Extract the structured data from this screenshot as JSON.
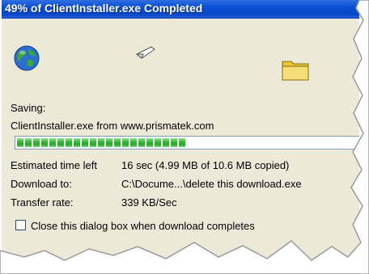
{
  "window": {
    "title": "49% of ClientInstaller.exe Completed"
  },
  "status": {
    "saving_label": "Saving:",
    "file_source": "ClientInstaller.exe from www.prismatek.com",
    "progress_percent": 49
  },
  "details": {
    "estimated_label": "Estimated time left",
    "estimated_value": "16 sec (4.99 MB of 10.6 MB copied)",
    "download_to_label": "Download to:",
    "download_to_value": "C:\\Docume...\\delete this download.exe",
    "transfer_rate_label": "Transfer rate:",
    "transfer_rate_value": "339 KB/Sec"
  },
  "options": {
    "close_on_complete_label": "Close this dialog box when download completes",
    "close_on_complete_checked": false
  },
  "icons": {
    "globe": "globe-icon",
    "paper": "flying-paper-icon",
    "folder": "folder-icon"
  },
  "colors": {
    "titlebar": "#0a4fd6",
    "dialog_bg": "#ece9d8",
    "progress_green": "#2fb82f"
  }
}
